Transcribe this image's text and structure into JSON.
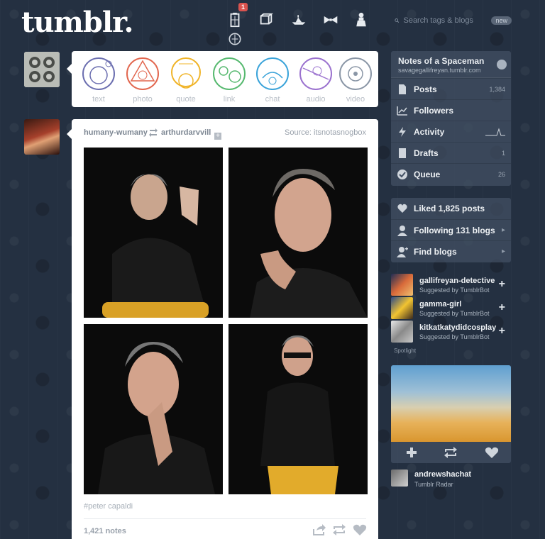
{
  "header": {
    "logo": "tumblr.",
    "notification_count": "1",
    "search_placeholder": "Search tags & blogs",
    "search_badge": "new",
    "icons": [
      "tardis-icon",
      "cube-icon",
      "ship-icon",
      "bowtie-icon",
      "dalek-icon",
      "compass-icon"
    ]
  },
  "post_types": [
    {
      "label": "text",
      "color": "#6c6fb0"
    },
    {
      "label": "photo",
      "color": "#e2674f"
    },
    {
      "label": "quote",
      "color": "#f0b429"
    },
    {
      "label": "link",
      "color": "#56b96f"
    },
    {
      "label": "chat",
      "color": "#3aa3d9"
    },
    {
      "label": "audio",
      "color": "#9b72cf"
    },
    {
      "label": "video",
      "color": "#8a96a6"
    }
  ],
  "post": {
    "author": "humany-wumany",
    "reblogged_from": "arthurdarvvill",
    "source": "Source: itsnotasnogbox",
    "tag": "#peter capaldi",
    "notes": "1,421 notes"
  },
  "blog": {
    "name": "Notes of a Spaceman",
    "url": "savagegallifreyan.tumblr.com",
    "items": [
      {
        "label": "Posts",
        "count": "1,384",
        "icon": "document-icon"
      },
      {
        "label": "Followers",
        "count": "",
        "icon": "chart-icon"
      },
      {
        "label": "Activity",
        "count": "",
        "icon": "lightning-icon"
      },
      {
        "label": "Drafts",
        "count": "1",
        "icon": "drafts-icon"
      },
      {
        "label": "Queue",
        "count": "26",
        "icon": "queue-icon"
      }
    ]
  },
  "social": {
    "items": [
      {
        "label": "Liked 1,825 posts",
        "icon": "heart-icon"
      },
      {
        "label": "Following 131 blogs",
        "icon": "person-icon"
      },
      {
        "label": "Find blogs",
        "icon": "add-person-icon"
      }
    ]
  },
  "recommended": [
    {
      "name": "gallifreyan-detective",
      "sub": "Suggested by TumblrBot"
    },
    {
      "name": "gamma-girl",
      "sub": "Suggested by TumblrBot"
    },
    {
      "name": "kitkatkatydidcosplay",
      "sub": "Suggested by TumblrBot"
    }
  ],
  "spotlight_label": "Spotlight",
  "radar": {
    "user": "andrewshachat",
    "sub": "Tumblr Radar"
  }
}
